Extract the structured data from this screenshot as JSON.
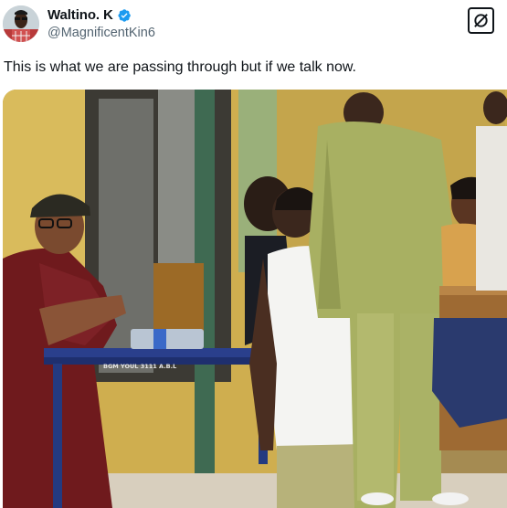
{
  "tweet": {
    "author": {
      "display_name": "Waltino. K",
      "handle": "@MagnificentKin6",
      "verified": true,
      "avatar_icon": "profile-photo"
    },
    "text": "This is what we are passing through but if we talk now.",
    "grok_icon": "grok-icon",
    "media": {
      "type": "photo",
      "table_label": "BGM YOUL 3111 A.B.L",
      "photo_icon": "photo"
    }
  },
  "colors": {
    "verified_blue": "#1d9bf0",
    "text_primary": "#0f1419",
    "text_secondary": "#536471"
  }
}
